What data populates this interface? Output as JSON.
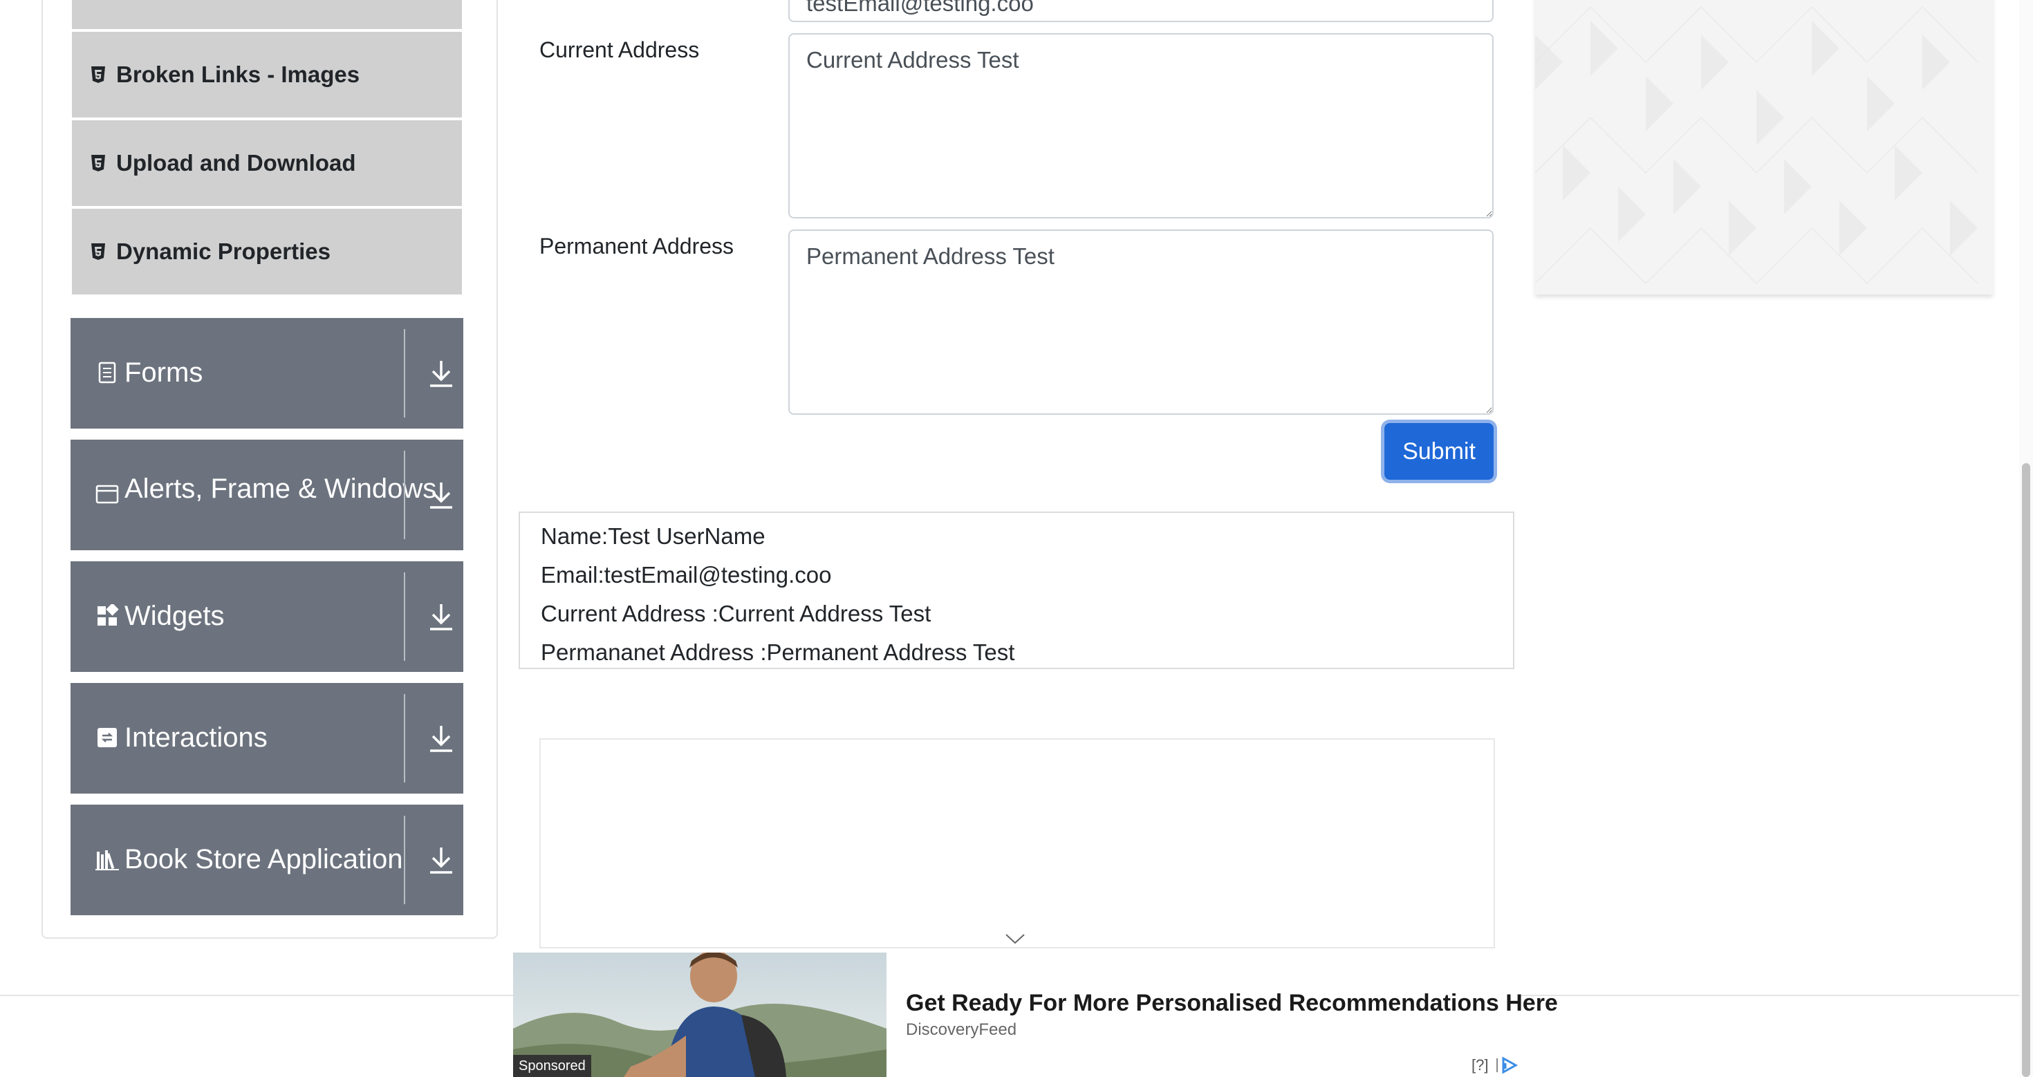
{
  "sidebar": {
    "elements_items": [
      {
        "label": ""
      },
      {
        "label": "Broken Links - Images"
      },
      {
        "label": "Upload and Download"
      },
      {
        "label": "Dynamic Properties"
      }
    ],
    "groups": [
      {
        "label": "Forms",
        "icon": "form-icon"
      },
      {
        "label": "Alerts, Frame & Windows",
        "icon": "window-icon"
      },
      {
        "label": "Widgets",
        "icon": "widgets-icon"
      },
      {
        "label": "Interactions",
        "icon": "interactions-icon"
      },
      {
        "label": "Book Store Application",
        "icon": "books-icon"
      }
    ]
  },
  "form": {
    "email_value": "testEmail@testing.coo",
    "current_address_label": "Current Address",
    "current_address_value": "Current Address Test",
    "permanent_address_label": "Permanent Address",
    "permanent_address_value": "Permanent Address Test",
    "submit_label": "Submit"
  },
  "output": {
    "name": "Name:Test UserName",
    "email": "Email:testEmail@testing.coo",
    "current_address": "Current Address :Current Address Test",
    "permanent_address": "Permananet Address :Permanent Address Test"
  },
  "ad": {
    "title": "Get Ready For More Personalised Recommendations Here",
    "source": "DiscoveryFeed",
    "sponsored": "Sponsored",
    "help": "[?]"
  },
  "colors": {
    "group_bg": "#6c737e",
    "sub_item_bg": "#d0d0d0",
    "submit_bg": "#1f68d8"
  }
}
